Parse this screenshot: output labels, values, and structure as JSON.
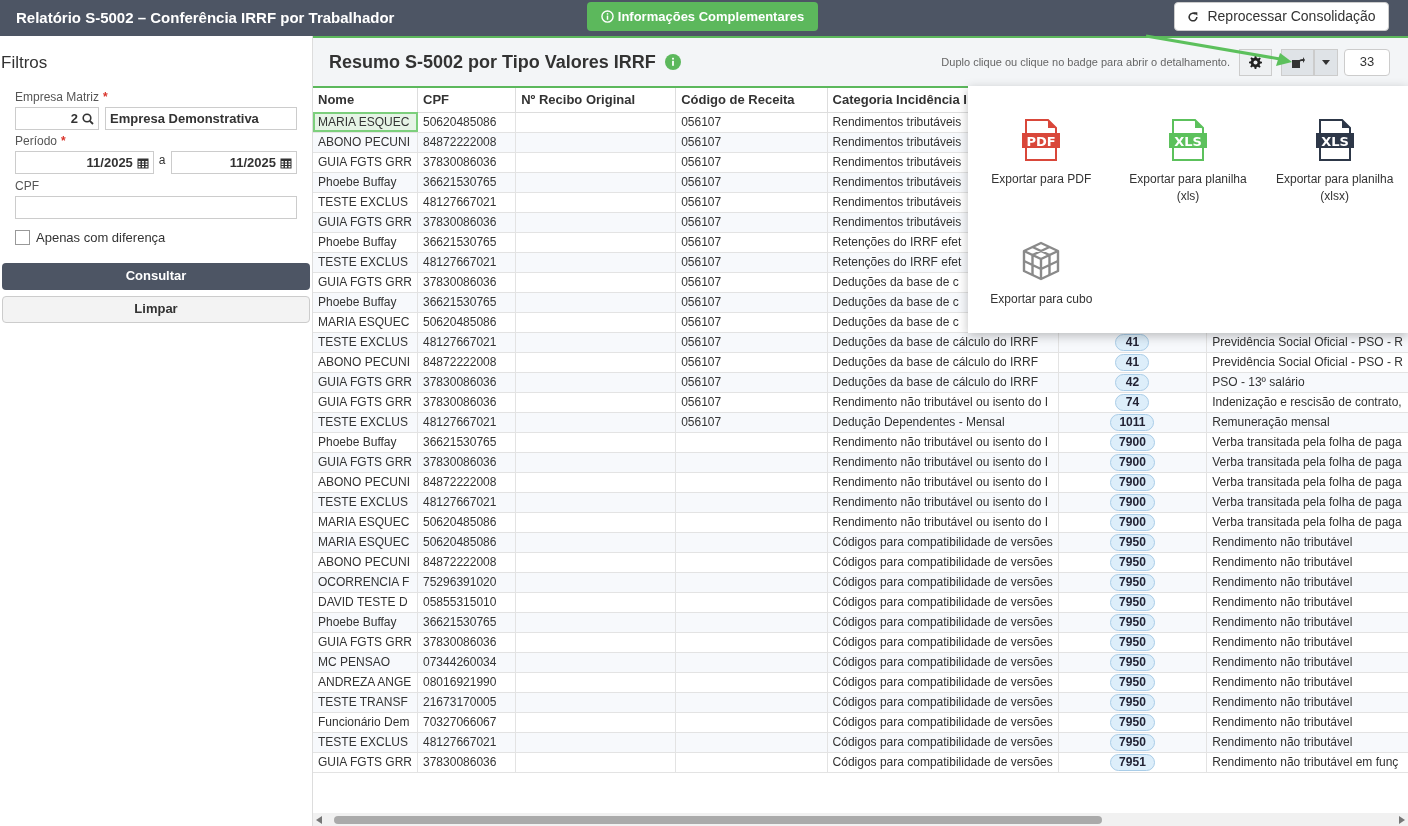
{
  "topbar": {
    "title": "Relatório S-5002 – Conferência IRRF por Trabalhador",
    "info_button": "Informações Complementares",
    "reprocess_button": "Reprocessar Consolidação"
  },
  "filters": {
    "title": "Filtros",
    "empresa": {
      "label": "Empresa Matriz",
      "required_mark": "*",
      "code": "2",
      "name": "Empresa Demonstrativa"
    },
    "periodo": {
      "label": "Período",
      "required_mark": "*",
      "from": "11/2025",
      "separator": "a",
      "to": "11/2025"
    },
    "cpf": {
      "label": "CPF"
    },
    "only_diff": {
      "label": "Apenas com diferença",
      "checked": false
    },
    "buttons": [
      {
        "label": "Consultar",
        "kind": "primary"
      },
      {
        "label": "Limpar",
        "kind": "secondary"
      }
    ]
  },
  "panel": {
    "title": "Resumo S-5002 por Tipo Valores IRRF",
    "hint": "Duplo clique ou clique no badge para abrir o detalhamento.",
    "count": "33",
    "export_menu_open": true
  },
  "export_menu": [
    {
      "label": "Exportar para PDF",
      "kind": "pdf",
      "icon_text": "PDF"
    },
    {
      "label": "Exportar para planilha (xls)",
      "kind": "xls",
      "icon_text": "XLS"
    },
    {
      "label": "Exportar para planilha (xlsx)",
      "kind": "xlsx",
      "icon_text": "XLS"
    },
    {
      "label": "Exportar para cubo",
      "kind": "cube"
    }
  ],
  "table": {
    "columns": [
      "Nome",
      "CPF",
      "Nº Recibo Original",
      "Código de Receita",
      "Categoria Incidência I"
    ],
    "rows": [
      {
        "nome": "MARIA ESQUEC",
        "cpf": "50620485086",
        "codigo": "056107",
        "categoria": "Rendimentos tributáveis",
        "focused": true
      },
      {
        "nome": "ABONO PECUNI",
        "cpf": "84872222008",
        "codigo": "056107",
        "categoria": "Rendimentos tributáveis",
        "focused": false
      },
      {
        "nome": "GUIA FGTS GRR",
        "cpf": "37830086036",
        "codigo": "056107",
        "categoria": "Rendimentos tributáveis",
        "focused": false
      },
      {
        "nome": "Phoebe Buffay",
        "cpf": "36621530765",
        "codigo": "056107",
        "categoria": "Rendimentos tributáveis",
        "focused": false
      },
      {
        "nome": "TESTE EXCLUS",
        "cpf": "48127667021",
        "codigo": "056107",
        "categoria": "Rendimentos tributáveis",
        "focused": false
      },
      {
        "nome": "GUIA FGTS GRR",
        "cpf": "37830086036",
        "codigo": "056107",
        "categoria": "Rendimentos tributáveis",
        "focused": false
      },
      {
        "nome": "Phoebe Buffay",
        "cpf": "36621530765",
        "codigo": "056107",
        "categoria": "Retenções do IRRF efet",
        "focused": false
      },
      {
        "nome": "TESTE EXCLUS",
        "cpf": "48127667021",
        "codigo": "056107",
        "categoria": "Retenções do IRRF efet",
        "focused": false
      },
      {
        "nome": "GUIA FGTS GRR",
        "cpf": "37830086036",
        "codigo": "056107",
        "categoria": "Deduções da base de c",
        "focused": false
      },
      {
        "nome": "Phoebe Buffay",
        "cpf": "36621530765",
        "codigo": "056107",
        "categoria": "Deduções da base de c",
        "focused": false
      },
      {
        "nome": "MARIA ESQUEC",
        "cpf": "50620485086",
        "codigo": "056107",
        "categoria": "Deduções da base de c",
        "focused": false
      },
      {
        "nome": "TESTE EXCLUS",
        "cpf": "48127667021",
        "codigo": "056107",
        "categoria": "Deduções da base de cálculo do IRRF",
        "badge": "41",
        "descricao": "Previdência Social Oficial - PSO - R",
        "focused": false
      },
      {
        "nome": "ABONO PECUNI",
        "cpf": "84872222008",
        "codigo": "056107",
        "categoria": "Deduções da base de cálculo do IRRF",
        "badge": "41",
        "descricao": "Previdência Social Oficial - PSO - R",
        "focused": false
      },
      {
        "nome": "GUIA FGTS GRR",
        "cpf": "37830086036",
        "codigo": "056107",
        "categoria": "Deduções da base de cálculo do IRRF",
        "badge": "42",
        "descricao": "PSO - 13º salário",
        "focused": false
      },
      {
        "nome": "GUIA FGTS GRR",
        "cpf": "37830086036",
        "codigo": "056107",
        "categoria": "Rendimento não tributável ou isento do I",
        "badge": "74",
        "descricao": "Indenização e rescisão de contrato,",
        "focused": false
      },
      {
        "nome": "TESTE EXCLUS",
        "cpf": "48127667021",
        "codigo": "056107",
        "categoria": "Dedução Dependentes - Mensal",
        "badge": "1011",
        "descricao": "Remuneração mensal",
        "focused": false
      },
      {
        "nome": "Phoebe Buffay",
        "cpf": "36621530765",
        "categoria": "Rendimento não tributável ou isento do I",
        "badge": "7900",
        "descricao": "Verba transitada pela folha de paga",
        "focused": false
      },
      {
        "nome": "GUIA FGTS GRR",
        "cpf": "37830086036",
        "categoria": "Rendimento não tributável ou isento do I",
        "badge": "7900",
        "descricao": "Verba transitada pela folha de paga",
        "focused": false
      },
      {
        "nome": "ABONO PECUNI",
        "cpf": "84872222008",
        "categoria": "Rendimento não tributável ou isento do I",
        "badge": "7900",
        "descricao": "Verba transitada pela folha de paga",
        "focused": false
      },
      {
        "nome": "TESTE EXCLUS",
        "cpf": "48127667021",
        "categoria": "Rendimento não tributável ou isento do I",
        "badge": "7900",
        "descricao": "Verba transitada pela folha de paga",
        "focused": false
      },
      {
        "nome": "MARIA ESQUEC",
        "cpf": "50620485086",
        "categoria": "Rendimento não tributável ou isento do I",
        "badge": "7900",
        "descricao": "Verba transitada pela folha de paga",
        "focused": false
      },
      {
        "nome": "MARIA ESQUEC",
        "cpf": "50620485086",
        "categoria": "Códigos para compatibilidade de versões",
        "badge": "7950",
        "descricao": "Rendimento não tributável",
        "focused": false
      },
      {
        "nome": "ABONO PECUNI",
        "cpf": "84872222008",
        "categoria": "Códigos para compatibilidade de versões",
        "badge": "7950",
        "descricao": "Rendimento não tributável",
        "focused": false
      },
      {
        "nome": "OCORRENCIA F",
        "cpf": "75296391020",
        "categoria": "Códigos para compatibilidade de versões",
        "badge": "7950",
        "descricao": "Rendimento não tributável",
        "focused": false
      },
      {
        "nome": "DAVID TESTE D",
        "cpf": "05855315010",
        "categoria": "Códigos para compatibilidade de versões",
        "badge": "7950",
        "descricao": "Rendimento não tributável",
        "focused": false
      },
      {
        "nome": "Phoebe Buffay",
        "cpf": "36621530765",
        "categoria": "Códigos para compatibilidade de versões",
        "badge": "7950",
        "descricao": "Rendimento não tributável",
        "focused": false
      },
      {
        "nome": "GUIA FGTS GRR",
        "cpf": "37830086036",
        "categoria": "Códigos para compatibilidade de versões",
        "badge": "7950",
        "descricao": "Rendimento não tributável",
        "focused": false
      },
      {
        "nome": "MC PENSAO",
        "cpf": "07344260034",
        "categoria": "Códigos para compatibilidade de versões",
        "badge": "7950",
        "descricao": "Rendimento não tributável",
        "focused": false
      },
      {
        "nome": "ANDREZA ANGE",
        "cpf": "08016921990",
        "categoria": "Códigos para compatibilidade de versões",
        "badge": "7950",
        "descricao": "Rendimento não tributável",
        "focused": false
      },
      {
        "nome": "TESTE TRANSF",
        "cpf": "21673170005",
        "categoria": "Códigos para compatibilidade de versões",
        "badge": "7950",
        "descricao": "Rendimento não tributável",
        "focused": false
      },
      {
        "nome": "Funcionário Dem",
        "cpf": "70327066067",
        "categoria": "Códigos para compatibilidade de versões",
        "badge": "7950",
        "descricao": "Rendimento não tributável",
        "focused": false
      },
      {
        "nome": "TESTE EXCLUS",
        "cpf": "48127667021",
        "categoria": "Códigos para compatibilidade de versões",
        "badge": "7950",
        "descricao": "Rendimento não tributável",
        "focused": false
      },
      {
        "nome": "GUIA FGTS GRR",
        "cpf": "37830086036",
        "categoria": "Códigos para compatibilidade de versões",
        "badge": "7951",
        "descricao": "Rendimento não tributável em funç",
        "focused": false
      }
    ]
  }
}
